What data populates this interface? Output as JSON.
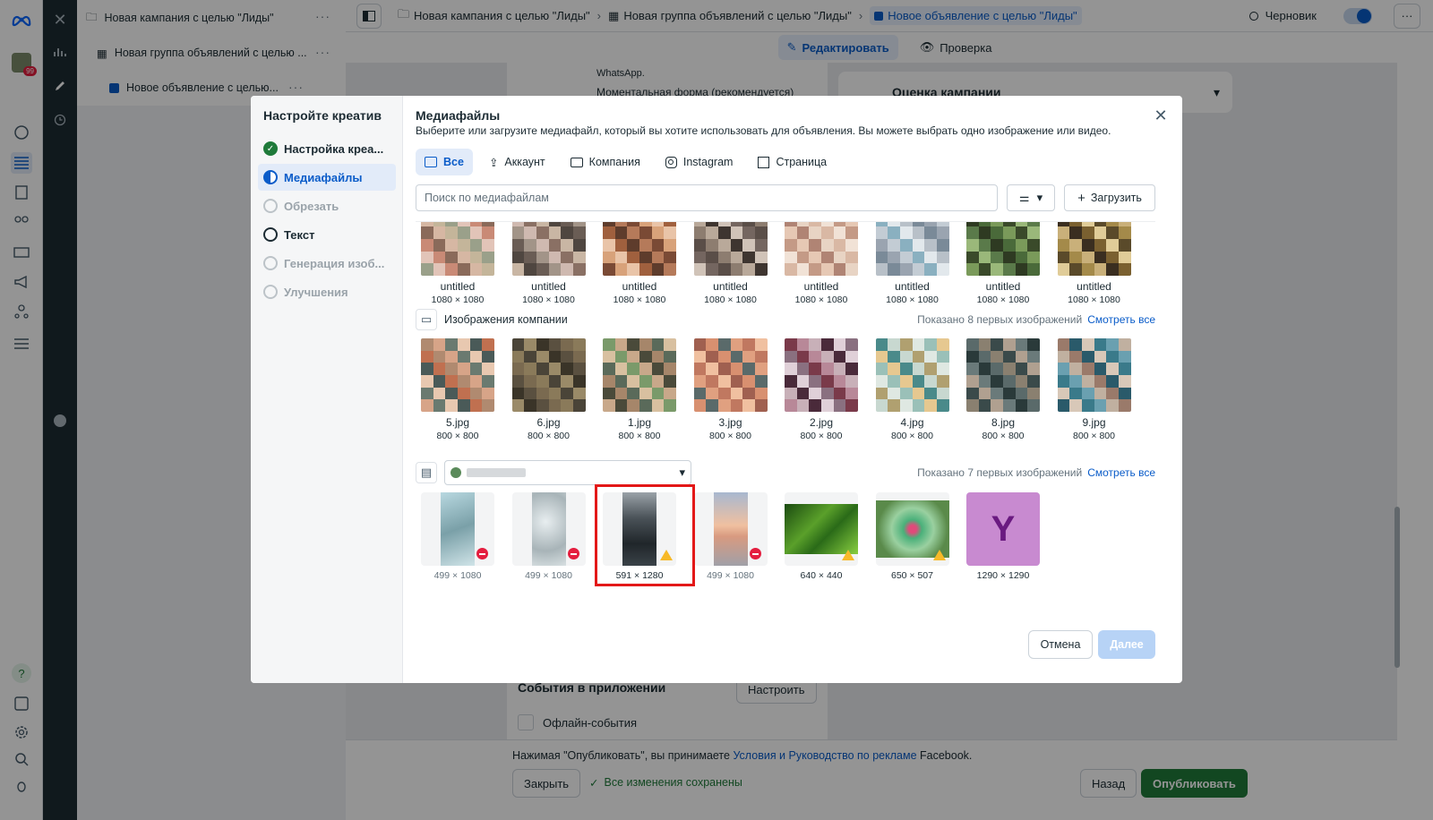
{
  "tree": {
    "campaign": "Новая кампания с целью \"Лиды\"",
    "adset": "Новая группа объявлений с целью ...",
    "ad": "Новое объявление с целью..."
  },
  "rail": {
    "notification_count": "99"
  },
  "topbar": {
    "crumbs": [
      "Новая кампания с целью \"Лиды\"",
      "Новая группа объявлений с целью \"Лиды\"",
      "Новое объявление с целью \"Лиды\""
    ],
    "status": "Черновик"
  },
  "subbar": {
    "edit": "Редактировать",
    "review": "Проверка"
  },
  "background": {
    "whatsapp": "WhatsApp.",
    "instant_form": "Моментальная форма (рекомендуется)",
    "evaluation": "Оценка кампании",
    "app_events": "События в приложении",
    "configure": "Настроить",
    "offline_events": "Офлайн-события"
  },
  "footer": {
    "terms_prefix": "Нажимая \"Опубликовать\", вы принимаете ",
    "terms_link": "Условия и Руководство по рекламе",
    "terms_suffix": " Facebook.",
    "close": "Закрыть",
    "saved": "Все изменения сохранены",
    "back": "Назад",
    "publish": "Опубликовать"
  },
  "wizard": {
    "title": "Настройте креатив",
    "steps": [
      {
        "label": "Настройка креа...",
        "state": "done"
      },
      {
        "label": "Медиафайлы",
        "state": "active"
      },
      {
        "label": "Обрезать",
        "state": "muted"
      },
      {
        "label": "Текст",
        "state": "normal"
      },
      {
        "label": "Генерация изоб...",
        "state": "muted"
      },
      {
        "label": "Улучшения",
        "state": "muted"
      }
    ]
  },
  "media": {
    "title": "Медиафайлы",
    "subtitle": "Выберите или загрузите медиафайл, который вы хотите использовать для объявления. Вы можете выбрать одно изображение или видео.",
    "tabs": [
      "Все",
      "Аккаунт",
      "Компания",
      "Instagram",
      "Страница"
    ],
    "search_placeholder": "Поиск по медиафайлам",
    "upload": "Загрузить",
    "cancel": "Отмена",
    "next": "Далее",
    "account_images": [
      {
        "name": "untitled",
        "dims": "1080 × 1080"
      },
      {
        "name": "untitled",
        "dims": "1080 × 1080"
      },
      {
        "name": "untitled",
        "dims": "1080 × 1080"
      },
      {
        "name": "untitled",
        "dims": "1080 × 1080"
      },
      {
        "name": "untitled",
        "dims": "1080 × 1080"
      },
      {
        "name": "untitled",
        "dims": "1080 × 1080"
      },
      {
        "name": "untitled",
        "dims": "1080 × 1080"
      },
      {
        "name": "untitled",
        "dims": "1080 × 1080"
      }
    ],
    "company_section": {
      "title": "Изображения компании",
      "shown": "Показано 8 первых изображений",
      "see_all": "Смотреть все",
      "images": [
        {
          "name": "5.jpg",
          "dims": "800 × 800"
        },
        {
          "name": "6.jpg",
          "dims": "800 × 800"
        },
        {
          "name": "1.jpg",
          "dims": "800 × 800"
        },
        {
          "name": "3.jpg",
          "dims": "800 × 800"
        },
        {
          "name": "2.jpg",
          "dims": "800 × 800"
        },
        {
          "name": "4.jpg",
          "dims": "800 × 800"
        },
        {
          "name": "8.jpg",
          "dims": "800 × 800"
        },
        {
          "name": "9.jpg",
          "dims": "800 × 800"
        }
      ]
    },
    "page_section": {
      "shown": "Показано 7 первых изображений",
      "see_all": "Смотреть все",
      "images": [
        {
          "dims": "499 × 1080",
          "badge": "blocked"
        },
        {
          "dims": "499 × 1080",
          "badge": "blocked"
        },
        {
          "dims": "591 × 1280",
          "badge": "warning",
          "selected": true
        },
        {
          "dims": "499 × 1080",
          "badge": "blocked"
        },
        {
          "dims": "640 × 440",
          "badge": "warning"
        },
        {
          "dims": "650 × 507",
          "badge": "warning"
        },
        {
          "dims": "1290 × 1290",
          "badge": "none",
          "letter": "Y"
        }
      ]
    }
  },
  "colors": {
    "accent": "#0a5cc9",
    "publish": "#1f7a3a",
    "selection": "#e31818"
  }
}
